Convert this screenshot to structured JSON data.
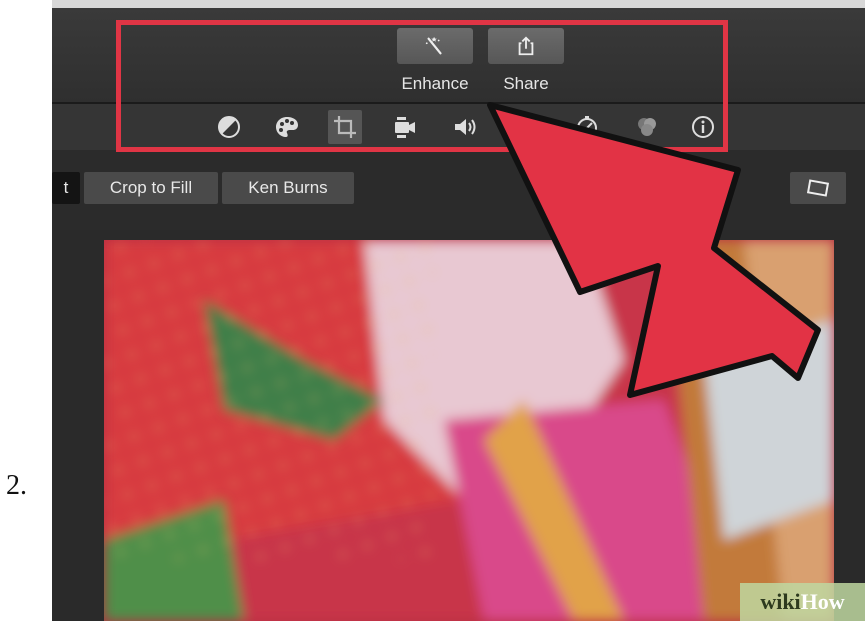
{
  "step": {
    "number": "2."
  },
  "toolbar": {
    "enhance_label": "Enhance",
    "share_label": "Share",
    "enhance_icon": "magic-wand-icon",
    "share_icon": "share-icon"
  },
  "adjustments": {
    "icons": [
      "color-balance-icon",
      "color-palette-icon",
      "crop-icon",
      "stabilization-camera-icon",
      "volume-icon",
      "speed-icon",
      "clip-filter-icon",
      "info-icon"
    ],
    "active": "crop-icon"
  },
  "crop_modes": {
    "fit_partial": "t",
    "crop_to_fill": "Crop to Fill",
    "ken_burns": "Ken Burns"
  },
  "colors": {
    "highlight": "#e03545",
    "arrow": "#e23345"
  },
  "watermark": {
    "wiki": "wiki",
    "how": "How"
  }
}
